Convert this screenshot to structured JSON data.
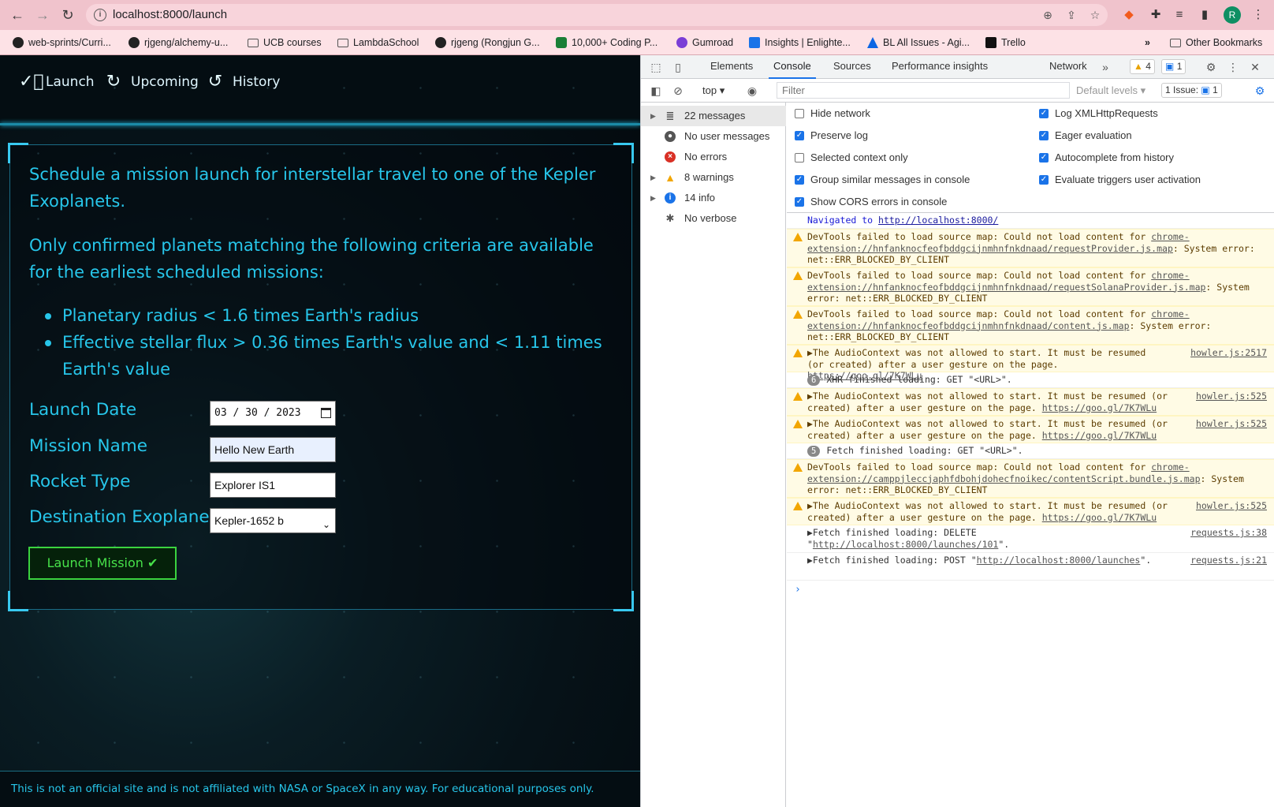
{
  "browser": {
    "url": "localhost:8000/launch",
    "avatar_letter": "R",
    "bookmarks": [
      "web-sprints/Curri...",
      "rjgeng/alchemy-u...",
      "UCB courses",
      "LambdaSchool",
      "rjgeng (Rongjun G...",
      "10,000+ Coding P...",
      "Gumroad",
      "Insights | Enlighte...",
      "BL All Issues - Agi...",
      "Trello"
    ],
    "bookmarks_more": "»",
    "other_bookmarks": "Other Bookmarks"
  },
  "app": {
    "nav": [
      {
        "label": "Launch",
        "icon": "check-circle-icon"
      },
      {
        "label": "Upcoming",
        "icon": "refresh-icon"
      },
      {
        "label": "History",
        "icon": "history-icon"
      }
    ],
    "intro": "Schedule a mission launch for interstellar travel to one of the Kepler Exoplanets.",
    "criteria_intro": "Only confirmed planets matching the following criteria are available for the earliest scheduled missions:",
    "criteria": [
      "Planetary radius < 1.6 times Earth's radius",
      "Effective stellar flux > 0.36 times Earth's value and < 1.11 times Earth's value"
    ],
    "form": {
      "launch_date_label": "Launch Date",
      "launch_date_value": "03 / 30 / 2023",
      "mission_name_label": "Mission Name",
      "mission_name_value": "Hello New Earth",
      "rocket_type_label": "Rocket Type",
      "rocket_type_value": "Explorer IS1",
      "destination_label": "Destination Exoplanet",
      "destination_value": "Kepler-1652 b",
      "submit_label": "Launch Mission ✔"
    },
    "footer": "This is not an official site and is not affiliated with NASA or SpaceX in any way. For educational purposes only."
  },
  "devtools": {
    "tabs": [
      "Elements",
      "Console",
      "Sources",
      "Performance insights",
      "Network"
    ],
    "selected_tab": "Console",
    "warn_count": "4",
    "issue_count": "1",
    "context": "top",
    "filter_placeholder": "Filter",
    "levels": "Default levels",
    "issues_label": "1 Issue:",
    "issues_num": "1",
    "sidebar": [
      {
        "label": "22 messages",
        "icon": "list-icon"
      },
      {
        "label": "No user messages",
        "icon": "user-icon"
      },
      {
        "label": "No errors",
        "icon": "error-icon"
      },
      {
        "label": "8 warnings",
        "icon": "warning-icon"
      },
      {
        "label": "14 info",
        "icon": "info-icon"
      },
      {
        "label": "No verbose",
        "icon": "bug-icon"
      }
    ],
    "settings_left": [
      {
        "label": "Hide network",
        "checked": false
      },
      {
        "label": "Preserve log",
        "checked": true
      },
      {
        "label": "Selected context only",
        "checked": false
      },
      {
        "label": "Group similar messages in console",
        "checked": true
      },
      {
        "label": "Show CORS errors in console",
        "checked": true
      }
    ],
    "settings_right": [
      {
        "label": "Log XMLHttpRequests",
        "checked": true
      },
      {
        "label": "Eager evaluation",
        "checked": true
      },
      {
        "label": "Autocomplete from history",
        "checked": true
      },
      {
        "label": "Evaluate triggers user activation",
        "checked": true
      }
    ],
    "messages": {
      "nav_text": "Navigated to ",
      "nav_link": "http://localhost:8000/",
      "w1a": "DevTools failed to load source map: Could not load content for ",
      "w1link": "chrome-extension://hnfanknocfeofbddgcijnmhnfnkdnaad/requestProvider.js.map",
      "w1b": ": System error: net::ERR_BLOCKED_BY_CLIENT",
      "w2link": "chrome-extension://hnfanknocfeofbddgcijnmhnfnkdnaad/requestSolanaProvider.js.map",
      "w3link": "chrome-extension://hnfanknocfeofbddgcijnmhnfnkdnaad/content.js.map",
      "audio": "▶The AudioContext was not allowed to start. It must be resumed (or created) after a user gesture on the page. ",
      "audio_link": "https://goo.gl/7K7WLu",
      "audio_src1": "howler.js:2517",
      "audio_src2": "howler.js:525",
      "xhr_count": "6",
      "xhr": "XHR finished loading: GET \"<URL>\".",
      "fetch_count": "5",
      "fetch": "Fetch finished loading: GET \"<URL>\".",
      "w4link": "chrome-extension://camppjleccjaphfdbohjdohecfnoikec/contentScript.bundle.js.map",
      "del_a": "▶Fetch finished loading: DELETE \"",
      "del_link": "http://localhost:8000/launches/101",
      "del_b": "\".",
      "del_src": "requests.js:38",
      "post_a": "▶Fetch finished loading: POST \"",
      "post_link": "http://localhost:8000/launches",
      "post_b": "\".",
      "post_src": "requests.js:21",
      "prompt": "›"
    }
  }
}
